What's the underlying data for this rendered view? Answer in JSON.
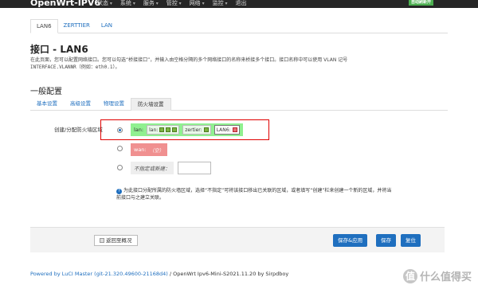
{
  "topbar": {
    "brand": "OpenWrt-IPV6",
    "menu": [
      "状态",
      "系统",
      "服务",
      "管控",
      "网络",
      "监控",
      "退出"
    ],
    "badge": "自动刷新开"
  },
  "tabs": [
    "LAN6",
    "ZERTTIER",
    "LAN"
  ],
  "page": {
    "title": "接口 - LAN6",
    "desc_line1": "在此页面，您可以配置网络接口。您可以勾选“桥接接口”，并输入由空格分隔的多个网络接口的名称来桥接多个接口。接口名称中可以使用 VLAN 记号",
    "desc_line2": "INTERFACE.VLANNR（例如：eth0.1）。"
  },
  "section": {
    "title": "一般配置",
    "subtabs": [
      "基本设置",
      "高级设置",
      "物理设置",
      "防火墙设置"
    ]
  },
  "firewall": {
    "label": "创建/分配防火墙区域",
    "zone_lan": {
      "name": "lan:",
      "chips": [
        "lan:",
        "zertier:",
        "LAN6:"
      ]
    },
    "zone_wan": {
      "name": "wan:",
      "empty": "（空）"
    },
    "zone_new": {
      "label": "不指定或新建：",
      "value": ""
    },
    "help_line1": "为此接口分配所属的防火墙区域，选择“不指定”可将该接口移出已关联的区域，或者填写“创建”栏来创建一个新的区域，并将当",
    "help_line2": "前接口与之建立关联。"
  },
  "actions": {
    "back": "返回至概况",
    "save_apply": "保存&应用",
    "save": "保存",
    "reset": "复位"
  },
  "footer": {
    "link": "Powered by LuCI Master (git-21.320.49600-21168d4)",
    "text": " / OpenWrt Ipv6-Mini-S2021.11.20 by Sirpdboy"
  },
  "watermark": {
    "icon": "值",
    "text": "什么值得买"
  }
}
